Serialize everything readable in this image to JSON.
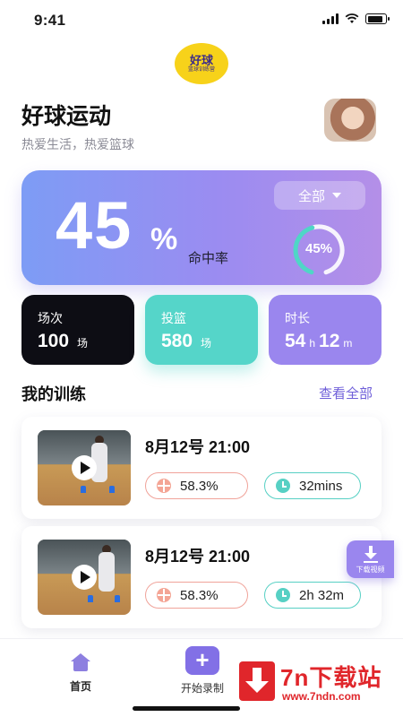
{
  "status_bar": {
    "time": "9:41"
  },
  "logo": {
    "main": "好球",
    "sub": "篮球训练营"
  },
  "header": {
    "title": "好球运动",
    "subtitle": "热爱生活，热爱篮球"
  },
  "hero": {
    "value": "45",
    "unit": "%",
    "label": "命中率",
    "filter_label": "全部",
    "ring_text": "45%",
    "ring_fraction": 0.45,
    "gradient": [
      "#7d9cf5",
      "#b48fe8"
    ]
  },
  "stats": [
    {
      "label": "场次",
      "value": "100",
      "unit": "场"
    },
    {
      "label": "投篮",
      "value": "580",
      "unit": "场"
    },
    {
      "label": "时长",
      "value_h": "54",
      "unit_h": "h",
      "value_m": "12",
      "unit_m": "m"
    }
  ],
  "section": {
    "title": "我的训练",
    "view_all": "查看全部"
  },
  "trainings": [
    {
      "title": "8月12号  21:00",
      "rate": "58.3%",
      "duration": "32mins"
    },
    {
      "title": "8月12号  21:00",
      "rate": "58.3%",
      "duration": "2h 32m"
    }
  ],
  "fab": {
    "label": "下载视频"
  },
  "tabbar": {
    "home": "首页",
    "record": "开始录制",
    "plus": "+"
  },
  "watermark": {
    "title": "7n下载站",
    "url": "www.7ndn.com"
  },
  "colors": {
    "accent": "#8270e6",
    "teal": "#55d5c9",
    "coral": "#f0a39a",
    "dark": "#0d0d14"
  }
}
